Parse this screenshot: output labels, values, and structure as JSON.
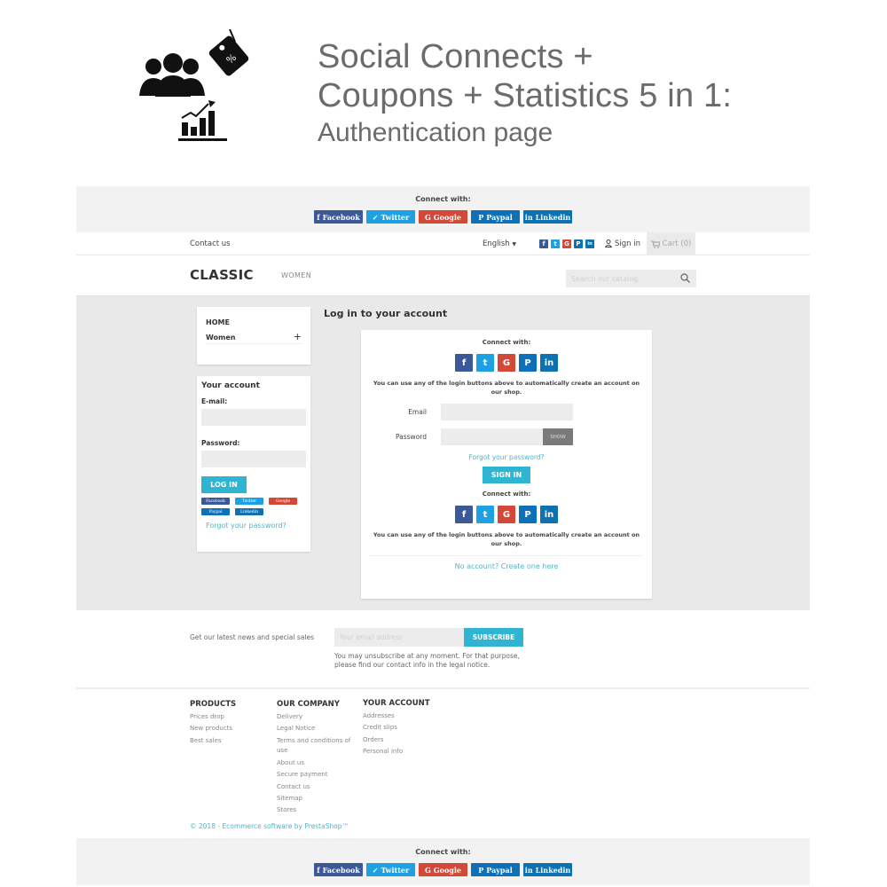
{
  "hero": {
    "title_line1": "Social Connects +",
    "title_line2": "Coupons + Statistics 5 in 1:",
    "subtitle": "Authentication page",
    "icons": [
      "users-group-icon",
      "discount-tag-icon",
      "growth-chart-icon"
    ]
  },
  "colors": {
    "facebook": "#3b5998",
    "twitter": "#1da1e2",
    "google": "#d34836",
    "paypal": "#0d70b8",
    "linkedin": "#0e72b0",
    "accent": "#2fb5d2",
    "link": "#52b4c8"
  },
  "connect_bar": {
    "label": "Connect with:",
    "buttons": [
      {
        "glyph": "f",
        "label": "Facebook"
      },
      {
        "glyph": "🐦",
        "label": "Twitter"
      },
      {
        "glyph": "G",
        "label": "Google"
      },
      {
        "glyph": "P",
        "label": "Paypal"
      },
      {
        "glyph": "in",
        "label": "Linkedin"
      }
    ]
  },
  "topnav": {
    "contact": "Contact us",
    "language": "English",
    "mini_icons": [
      "f",
      "t",
      "G",
      "P",
      "in"
    ],
    "signin": "Sign in",
    "cart": "Cart (0)"
  },
  "header": {
    "logo": "CLASSIC",
    "menu_item": "WOMEN",
    "search_placeholder": "Search our catalog"
  },
  "sidebar": {
    "categories": {
      "home": "HOME",
      "women": "Women",
      "expand": "+"
    },
    "account": {
      "title": "Your account",
      "email_label": "E-mail:",
      "password_label": "Password:",
      "login_button": "LOG IN",
      "social": [
        "Facebook",
        "Twitter",
        "Google",
        "Paypal",
        "Linkedin"
      ],
      "forgot": "Forgot your password?"
    }
  },
  "login": {
    "page_title": "Log in to your account",
    "connect_label": "Connect with:",
    "square_buttons": [
      "f",
      "t",
      "G",
      "P",
      "in"
    ],
    "note": "You can use any of the login buttons above to automatically create an account on our shop.",
    "email_label": "Email",
    "email_value": "",
    "password_label": "Password",
    "password_value": "",
    "show_button": "SHOW",
    "forgot": "Forgot your password?",
    "signin_button": "SIGN IN",
    "connect_label_2": "Connect with:",
    "note_2": "You can use any of the login buttons above to automatically create an account on our shop.",
    "no_account": "No account? Create one here"
  },
  "newsletter": {
    "text": "Get our latest news and special sales",
    "placeholder": "Your email address",
    "button": "SUBSCRIBE",
    "note": "You may unsubscribe at any moment. For that purpose, please find our contact info in the legal notice."
  },
  "footer": {
    "columns": [
      {
        "title": "PRODUCTS",
        "links": [
          "Prices drop",
          "New products",
          "Best sales"
        ]
      },
      {
        "title": "OUR COMPANY",
        "links": [
          "Delivery",
          "Legal Notice",
          "Terms and conditions of use",
          "About us",
          "Secure payment",
          "Contact us",
          "Sitemap",
          "Stores"
        ]
      },
      {
        "title": "YOUR ACCOUNT",
        "links": [
          "Addresses",
          "Credit slips",
          "Orders",
          "Personal info"
        ]
      }
    ],
    "copyright": "© 2018 - Ecommerce software by PrestaShop™"
  },
  "bottom_connect": {
    "label": "Connect with:",
    "buttons": [
      "Facebook",
      "Twitter",
      "Google",
      "Paypal",
      "Linkedin"
    ]
  }
}
